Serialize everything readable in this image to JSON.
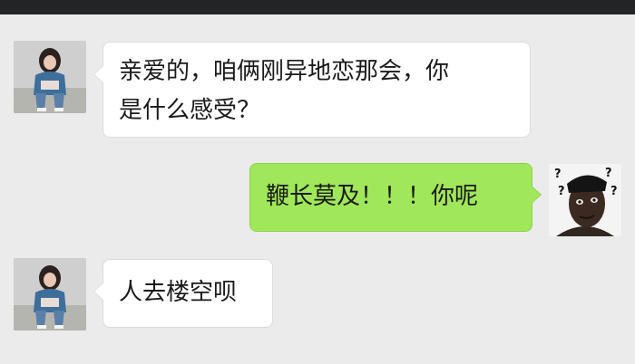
{
  "messages": [
    {
      "side": "left",
      "sender_avatar": "girl-avatar",
      "text": "亲爱的，咱俩刚异地恋那会，你\n是什么感受？"
    },
    {
      "side": "right",
      "sender_avatar": "confused-man-avatar",
      "text": "鞭长莫及！！！你呢"
    },
    {
      "side": "left",
      "sender_avatar": "girl-avatar",
      "text": "人去楼空呗"
    }
  ],
  "colors": {
    "background": "#ebebeb",
    "status_bar": "#222425",
    "left_bubble": "#ffffff",
    "right_bubble": "#a0e75a"
  }
}
